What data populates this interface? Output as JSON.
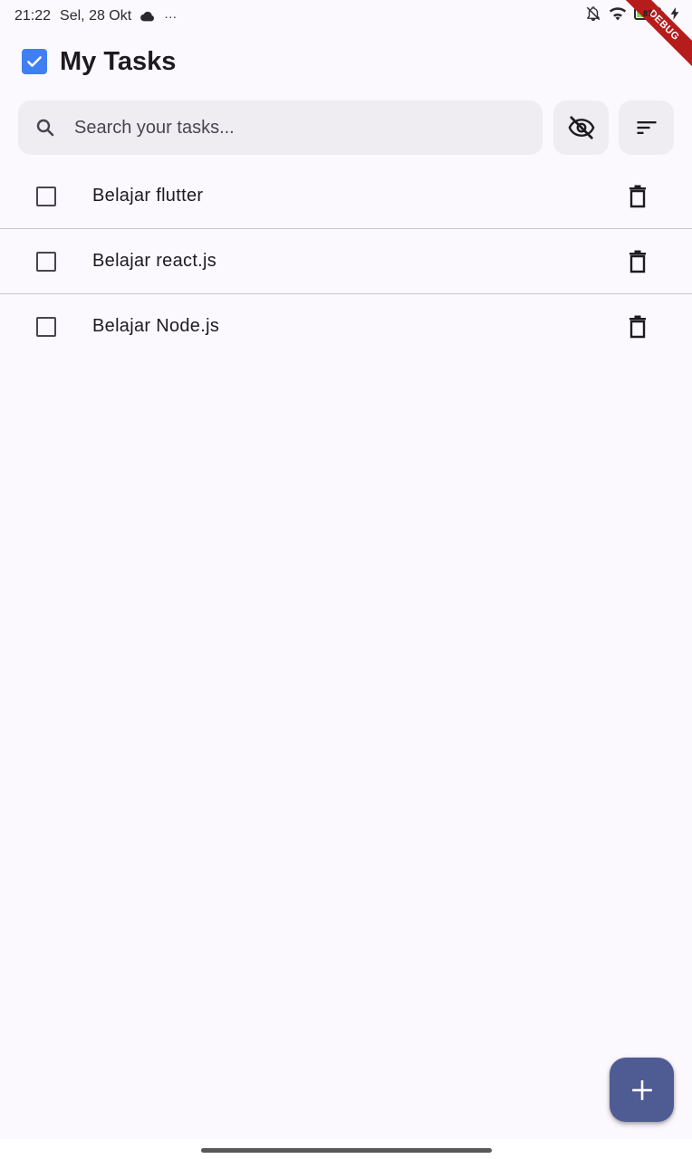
{
  "status_bar": {
    "time": "21:22",
    "date": "Sel, 28 Okt",
    "overflow": "···",
    "battery_level": "87",
    "icons": [
      "cloud-icon",
      "notifications-off-icon",
      "wifi-icon",
      "battery-icon",
      "charging-icon"
    ]
  },
  "debug_banner": "DEBUG",
  "header": {
    "title": "My Tasks",
    "icon": "checkbox-checked-icon",
    "accent_color": "#3f7ff1"
  },
  "search": {
    "placeholder": "Search your tasks...",
    "value": "",
    "icon": "search-icon"
  },
  "toolbar": {
    "visibility_icon": "visibility-off-icon",
    "sort_icon": "sort-icon"
  },
  "tasks": [
    {
      "title": "Belajar flutter",
      "completed": false
    },
    {
      "title": "Belajar react.js",
      "completed": false
    },
    {
      "title": "Belajar Node.js",
      "completed": false
    }
  ],
  "fab": {
    "icon": "add-icon",
    "color": "#4f5b93"
  },
  "colors": {
    "background": "#fbf8fe",
    "surface_container": "#efedf2",
    "divider": "#cac4d0"
  }
}
